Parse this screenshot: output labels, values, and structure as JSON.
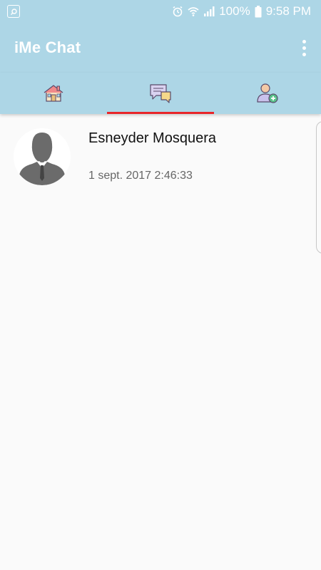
{
  "status_bar": {
    "battery": "100%",
    "time": "9:58 PM"
  },
  "app_bar": {
    "title": "iMe Chat"
  },
  "tabs": [
    {
      "icon": "home-icon",
      "selected": false
    },
    {
      "icon": "chat-bubbles-icon",
      "selected": true
    },
    {
      "icon": "add-contact-icon",
      "selected": false
    }
  ],
  "chats": [
    {
      "name": "Esneyder Mosquera",
      "time": "1 sept. 2017 2:46:33",
      "avatar": "default-person-avatar"
    }
  ],
  "colors": {
    "app_bar": "#add6e6",
    "tab_indicator": "#e8262a",
    "background": "#fafafa"
  }
}
